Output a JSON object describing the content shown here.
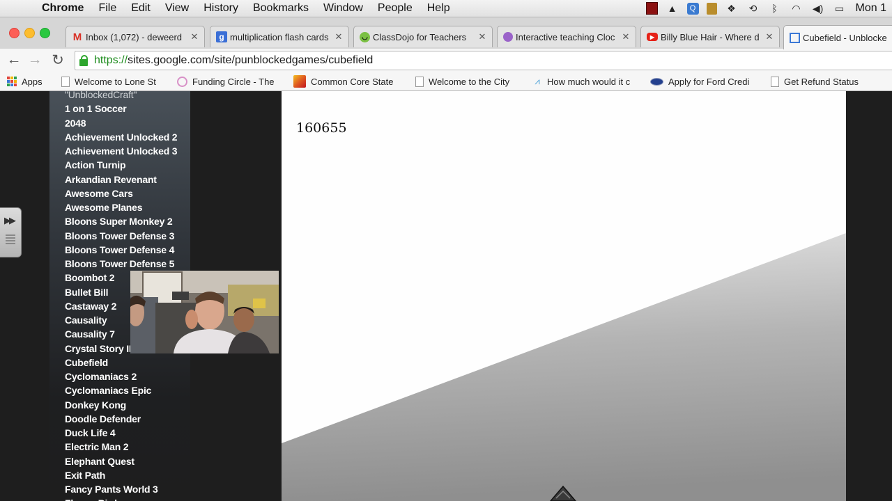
{
  "menubar": {
    "app_name": "Chrome",
    "menus": [
      "File",
      "Edit",
      "View",
      "History",
      "Bookmarks",
      "Window",
      "People",
      "Help"
    ],
    "clock": "Mon 1",
    "tray_icons": [
      "red-square-icon",
      "drive-icon",
      "q-app-icon",
      "notes-icon",
      "dropbox-icon",
      "time-machine-icon",
      "bluetooth-icon",
      "wifi-icon",
      "volume-icon",
      "battery-icon"
    ]
  },
  "tabs": [
    {
      "title": "Inbox (1,072) - deweerd",
      "icon": "gmail-icon"
    },
    {
      "title": "multiplication flash cards",
      "icon": "google-icon"
    },
    {
      "title": "ClassDojo for Teachers",
      "icon": "classdojo-icon"
    },
    {
      "title": "Interactive teaching Cloc",
      "icon": "clock-icon"
    },
    {
      "title": "Billy Blue Hair - Where d",
      "icon": "youtube-icon"
    },
    {
      "title": "Cubefield - Unblocke",
      "icon": "google-sites-icon",
      "active": true
    }
  ],
  "toolbar": {
    "url_scheme": "https://",
    "url_rest": "sites.google.com/site/punblockedgames/cubefield"
  },
  "bookmarks": [
    {
      "label": "Apps"
    },
    {
      "label": "Welcome to Lone St"
    },
    {
      "label": "Funding Circle - The"
    },
    {
      "label": "Common Core State"
    },
    {
      "label": "Welcome to the City"
    },
    {
      "label": "How much would it c"
    },
    {
      "label": "Apply for Ford Credi"
    },
    {
      "label": "Get Refund Status"
    }
  ],
  "sidebar": {
    "items": [
      "\"UnblockedCraft\"",
      "1 on 1 Soccer",
      "2048",
      "Achievement Unlocked 2",
      "Achievement Unlocked 3",
      "Action Turnip",
      "Arkandian Revenant",
      "Awesome Cars",
      "Awesome Planes",
      "Bloons Super Monkey 2",
      "Bloons Tower Defense 3",
      "Bloons Tower Defense 4",
      "Bloons Tower Defense 5",
      "Boombot 2",
      "Bullet Bill",
      "Castaway 2",
      "Causality",
      "Causality 7",
      "Crystal Story II",
      "Cubefield",
      "Cyclomaniacs 2",
      "Cyclomaniacs Epic",
      "Donkey Kong",
      "Doodle Defender",
      "Duck Life 4",
      "Electric Man 2",
      "Elephant Quest",
      "Exit Path",
      "Fancy Pants World 3",
      "Flappy Bird"
    ],
    "current": "Cubefield"
  },
  "game": {
    "score": "160655"
  },
  "colors": {
    "sidebar_top": "#495159",
    "page_bg": "#1e1e1e",
    "game_bg": "#fefefe",
    "ground": "#9a9a9a"
  }
}
